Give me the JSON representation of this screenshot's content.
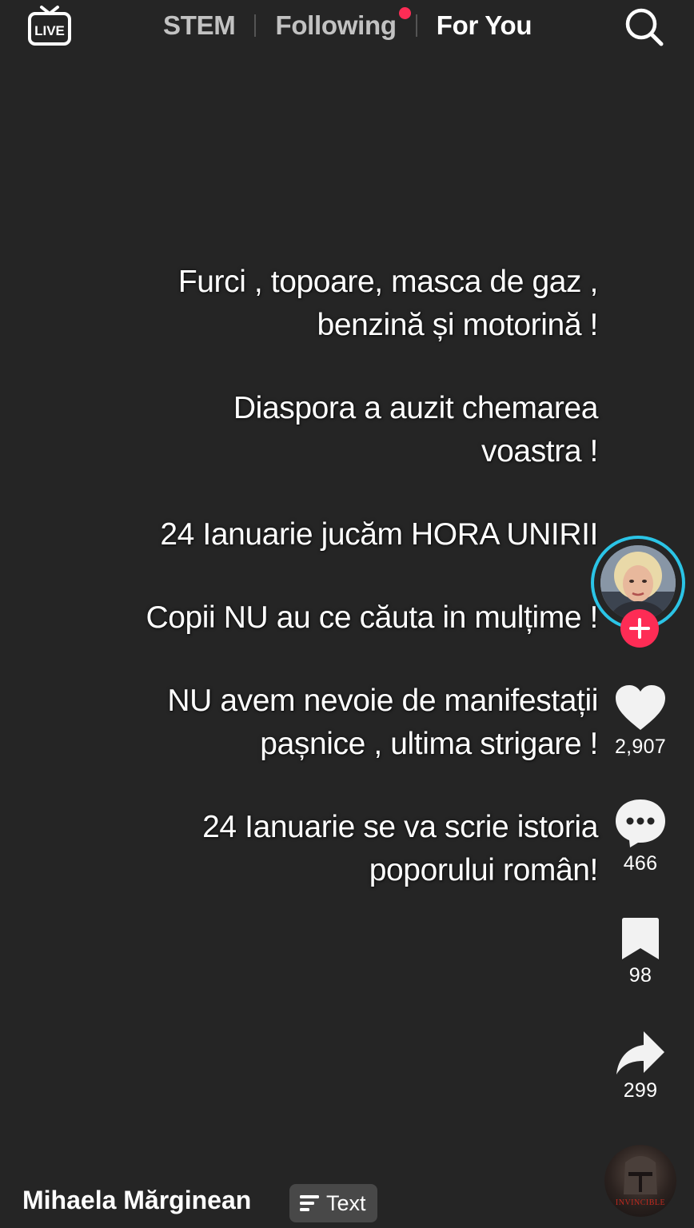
{
  "header": {
    "live_label": "LIVE",
    "tabs": [
      {
        "label": "STEM",
        "active": false
      },
      {
        "label": "Following",
        "active": false,
        "has_notification": true
      },
      {
        "label": "For You",
        "active": true
      }
    ]
  },
  "caption": {
    "paragraphs": [
      "Furci , topoare, masca de gaz ,\nbenzină și motorină !",
      "Diaspora a auzit chemarea\nvoastra !",
      "24 Ianuarie jucăm HORA UNIRII",
      "Copii NU au ce căuta in mulțime !",
      "NU avem nevoie de manifestații\npașnice , ultima strigare !",
      "24 Ianuarie se va scrie istoria\npoporului român!"
    ]
  },
  "actions": {
    "likes": "2,907",
    "comments": "466",
    "saves": "98",
    "shares": "299"
  },
  "music": {
    "disc_text": "INVINCIBLE"
  },
  "author": {
    "name": "Mihaela Mărginean"
  },
  "content_chip": {
    "label": "Text",
    "icon": "text-lines-icon"
  },
  "colors": {
    "background": "#252525",
    "accent": "#fe2c55",
    "live_ring": "#2bc4e6"
  }
}
